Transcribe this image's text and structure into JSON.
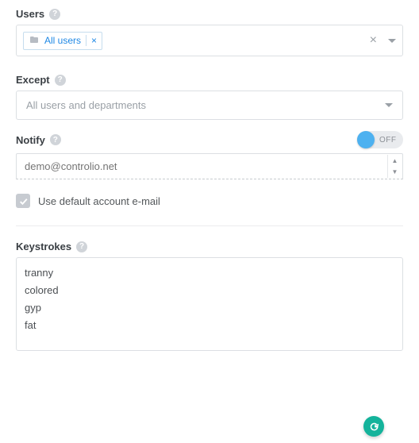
{
  "users": {
    "label": "Users",
    "tag_label": "All users"
  },
  "except": {
    "label": "Except",
    "placeholder": "All users and departments"
  },
  "notify": {
    "label": "Notify",
    "toggle_state": "OFF",
    "email_placeholder": "demo@controlio.net",
    "use_default_label": "Use default account e-mail"
  },
  "keystrokes": {
    "label": "Keystrokes",
    "items": [
      "tranny",
      "colored",
      "gyp",
      "fat"
    ]
  }
}
